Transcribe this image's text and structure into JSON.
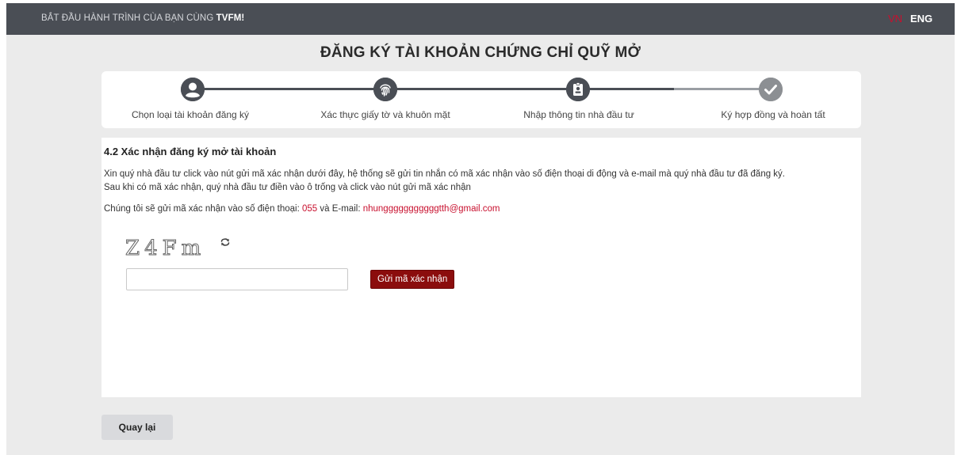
{
  "topbar": {
    "tagline_prefix": "BẮT ĐẦU HÀNH TRÌNH CÙA BẠN CÙNG",
    "tagline_brand": "TVFM!",
    "lang_vn": "VN",
    "lang_en": "ENG"
  },
  "page": {
    "title": "ĐĂNG KÝ TÀI KHOẢN CHỨNG CHỈ QUỸ MỞ"
  },
  "steps": [
    {
      "label": "Chọn loại tài khoản đăng ký",
      "icon": "user-circle-icon",
      "state": "done"
    },
    {
      "label": "Xác thực giấy tờ và khuôn mặt",
      "icon": "fingerprint-icon",
      "state": "done"
    },
    {
      "label": "Nhập thông tin nhà đầu tư",
      "icon": "id-badge-icon",
      "state": "current"
    },
    {
      "label": "Ký hợp đồng và hoàn tất",
      "icon": "check-circle-icon",
      "state": "pending"
    }
  ],
  "content": {
    "section_title": "4.2 Xác nhận đăng ký mở tài khoản",
    "instruction_line1": "Xin quý nhà đầu tư click vào nút gửi mã xác nhận dưới đây, hệ thống sẽ gửi tin nhắn có mã xác nhận vào số điện thoại di động và e-mail mà quý nhà đầu tư đã đăng ký.",
    "instruction_line2": "Sau khi có mã xác nhận, quý nhà đầu tư điền vào ô trống và click vào nút gửi mã xác nhận",
    "notice_prefix": "Chúng tôi sẽ gửi mã xác nhận vào số điện thoại:",
    "phone": "055",
    "notice_mid": "và E-mail:",
    "email": "nhungggggggggggtth@gmail.com",
    "captcha_text": "Z4Fm",
    "code_input_value": "",
    "send_button_label": "Gửi mã xác nhận"
  },
  "footer": {
    "back_button_label": "Quay lại"
  },
  "colors": {
    "accent": "#8b0d0d",
    "highlight": "#c8102e",
    "topbar": "#4a4e55"
  }
}
